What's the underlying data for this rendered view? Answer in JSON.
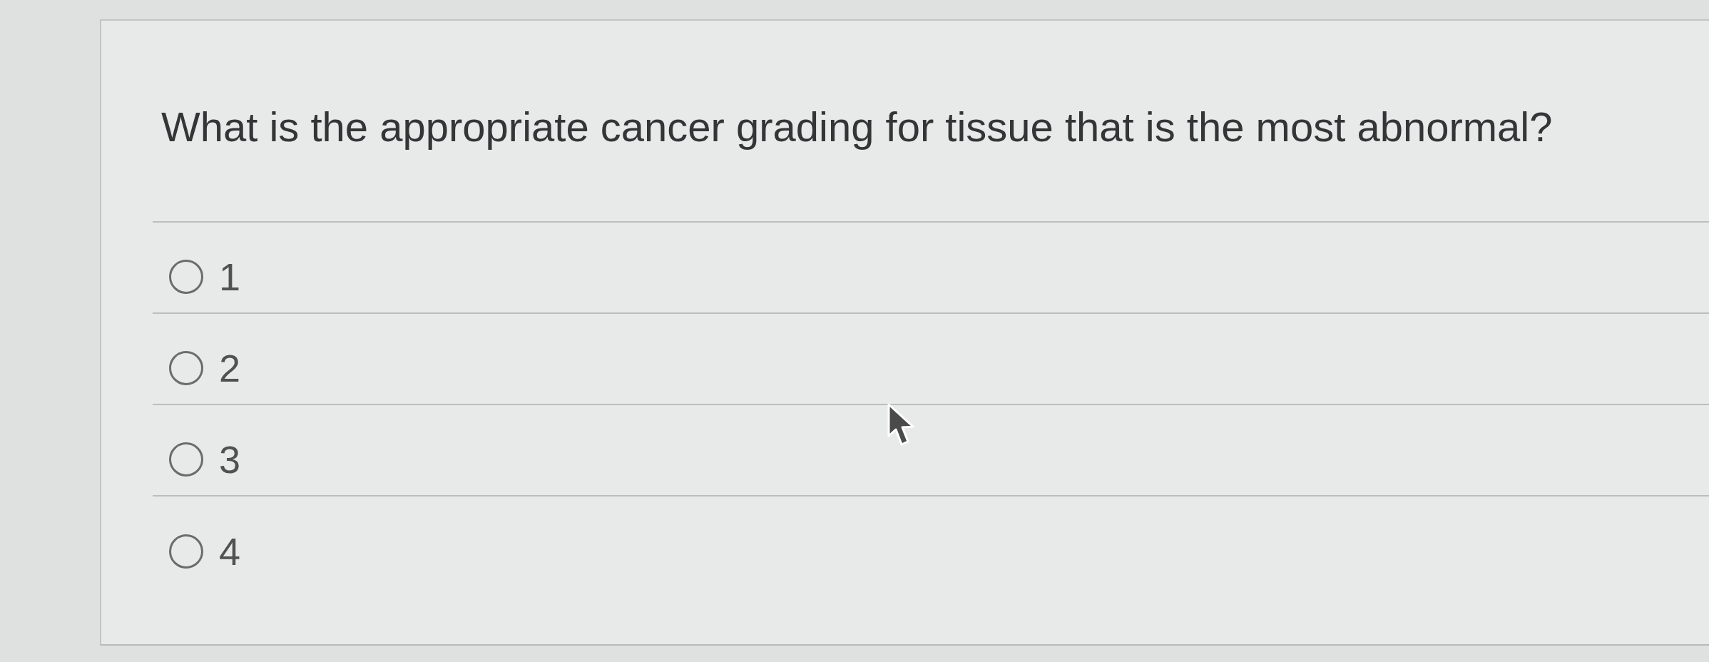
{
  "question": {
    "text": "What is the appropriate cancer grading for tissue that is the most abnormal?"
  },
  "options": [
    {
      "label": "1",
      "selected": false
    },
    {
      "label": "2",
      "selected": false
    },
    {
      "label": "3",
      "selected": false
    },
    {
      "label": "4",
      "selected": false
    }
  ]
}
